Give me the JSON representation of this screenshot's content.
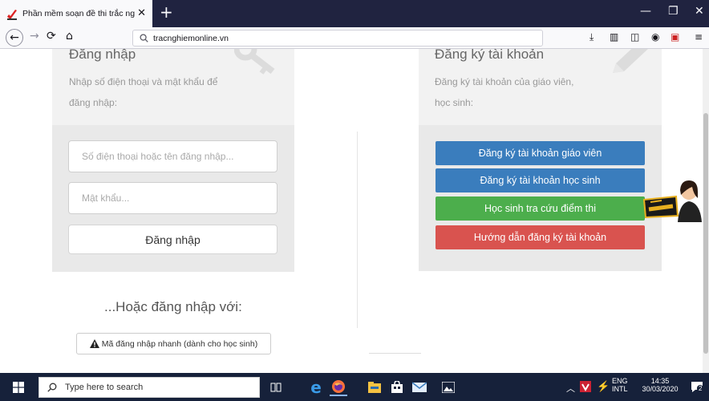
{
  "browser": {
    "tab_title": "Phần mềm soạn đề thi trắc nghi",
    "tab_close": "✕",
    "new_tab": "+",
    "url": "tracnghiemonline.vn",
    "window_min": "—",
    "window_restore": "❐",
    "window_close": "✕"
  },
  "login": {
    "heading": "Đăng nhập",
    "desc_line1": "Nhập số điện thoại và mật khẩu để",
    "desc_line2": "đăng nhập:",
    "username_placeholder": "Số điện thoại hoặc tên đăng nhập...",
    "password_placeholder": "Mật khẩu...",
    "submit_label": "Đăng nhập"
  },
  "alt_login": {
    "text": "...Hoặc đăng nhập với:",
    "quick_label": "Mã đăng nhập nhanh (dành cho học sinh)"
  },
  "register": {
    "heading": "Đăng ký tài khoản",
    "desc_line1": "Đăng ký tài khoản của giáo viên,",
    "desc_line2": "học sinh:",
    "buttons": [
      {
        "label": "Đăng ký tài khoản giáo viên",
        "color": "#3a7dbd"
      },
      {
        "label": "Đăng ký tài khoản học sinh",
        "color": "#3a7dbd"
      },
      {
        "label": "Học sinh tra cứu điểm thi",
        "color": "#4cae4c"
      },
      {
        "label": "Hướng dẫn đăng ký tài khoản",
        "color": "#d9534f"
      }
    ]
  },
  "taskbar": {
    "search_text": "Type here to search",
    "lang_top": "ENG",
    "lang_bottom": "INTL",
    "time": "14:35",
    "date": "30/03/2020",
    "notification_count": "2"
  }
}
